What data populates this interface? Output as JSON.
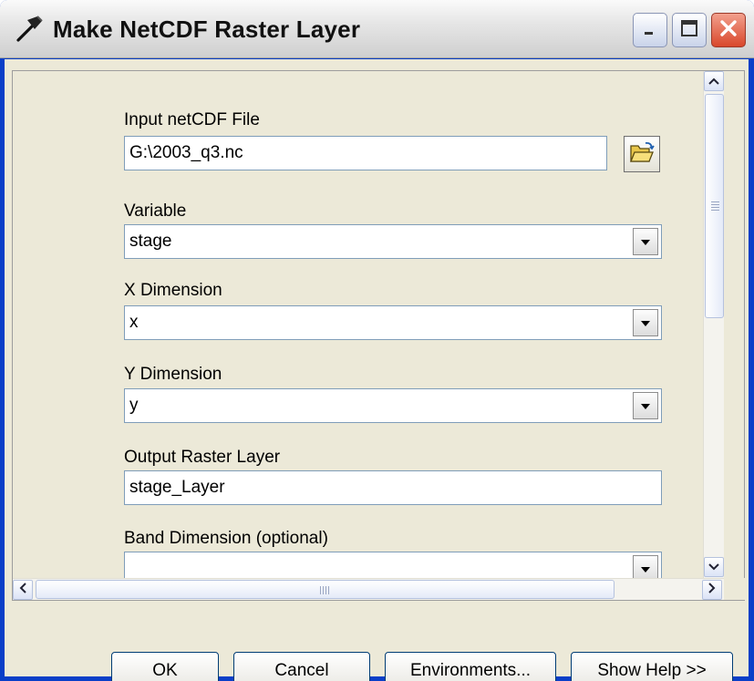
{
  "window": {
    "title": "Make NetCDF Raster Layer",
    "icon": "hammer-icon"
  },
  "form": {
    "input_file": {
      "label": "Input netCDF File",
      "value": "G:\\2003_q3.nc"
    },
    "variable": {
      "label": "Variable",
      "value": "stage"
    },
    "x_dimension": {
      "label": "X Dimension",
      "value": "x"
    },
    "y_dimension": {
      "label": "Y Dimension",
      "value": "y"
    },
    "output_layer": {
      "label": "Output Raster Layer",
      "value": "stage_Layer"
    },
    "band_dimension": {
      "label": "Band Dimension (optional)",
      "value": ""
    }
  },
  "buttons": {
    "ok": "OK",
    "cancel": "Cancel",
    "environments": "Environments...",
    "show_help": "Show Help >>"
  },
  "colors": {
    "dialog_background": "#ece9d8",
    "close_button": "#d9472b",
    "field_border": "#7f9db9"
  }
}
